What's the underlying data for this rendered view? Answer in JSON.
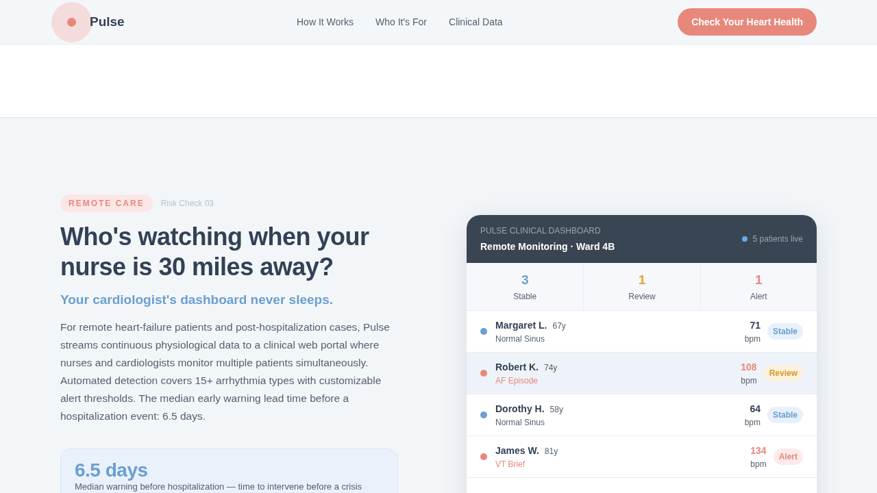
{
  "header": {
    "brand": "Pulse",
    "nav": [
      {
        "label": "How It Works"
      },
      {
        "label": "Who It's For"
      },
      {
        "label": "Clinical Data"
      }
    ],
    "cta": "Check Your Heart Health"
  },
  "hero": {
    "tag": "REMOTE CARE",
    "tag_note": "Risk Check 03",
    "title": "Who's watching when your nurse is 30 miles away?",
    "subtitle": "Your cardiologist's dashboard never sleeps.",
    "body": "For remote heart-failure patients and post-hospitalization cases, Pulse streams continuous physiological data to a clinical web portal where nurses and cardiologists monitor multiple patients simultaneously. Automated detection covers 15+ arrhythmia types with customizable alert thresholds. The median early warning lead time before a hospitalization event: 6.5 days.",
    "stat": {
      "value": "6.5 days",
      "caption": "Median warning before hospitalization — time to intervene before a crisis"
    }
  },
  "dashboard": {
    "eyebrow": "PULSE CLINICAL DASHBOARD",
    "title": "Remote Monitoring · Ward 4B",
    "live": "5 patients live",
    "summary": [
      {
        "value": "3",
        "label": "Stable",
        "kind": "stable"
      },
      {
        "value": "1",
        "label": "Review",
        "kind": "review"
      },
      {
        "value": "1",
        "label": "Alert",
        "kind": "alert"
      }
    ],
    "patients": [
      {
        "name": "Margaret L.",
        "age": "67y",
        "rhythm": "Normal Sinus",
        "bpm": "71",
        "unit": "bpm",
        "kind": "stable",
        "badge": "Stable",
        "color": "#6a9fd0",
        "selected": false
      },
      {
        "name": "Robert K.",
        "age": "74y",
        "rhythm": "AF Episode",
        "bpm": "108",
        "unit": "bpm",
        "kind": "review",
        "badge": "Review",
        "color": "#e8877c",
        "selected": true
      },
      {
        "name": "Dorothy H.",
        "age": "58y",
        "rhythm": "Normal Sinus",
        "bpm": "64",
        "unit": "bpm",
        "kind": "stable",
        "badge": "Stable",
        "color": "#6a9fd0",
        "selected": false
      },
      {
        "name": "James W.",
        "age": "81y",
        "rhythm": "VT Brief",
        "bpm": "134",
        "unit": "bpm",
        "kind": "alert",
        "badge": "Alert",
        "color": "#e8877c",
        "selected": false
      }
    ]
  }
}
